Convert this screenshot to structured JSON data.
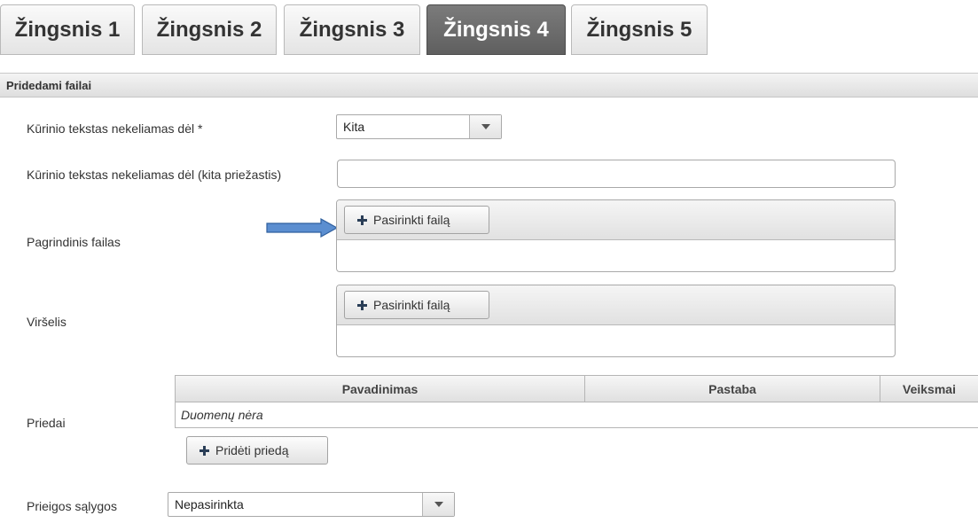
{
  "steps": [
    {
      "label": "Žingsnis 1",
      "active": false
    },
    {
      "label": "Žingsnis 2",
      "active": false
    },
    {
      "label": "Žingsnis 3",
      "active": false
    },
    {
      "label": "Žingsnis 4",
      "active": true
    },
    {
      "label": "Žingsnis 5",
      "active": false
    }
  ],
  "section": {
    "title": "Pridedami failai"
  },
  "form": {
    "reason": {
      "label": "Kūrinio tekstas nekeliamas dėl *",
      "value": "Kita"
    },
    "other_reason": {
      "label": "Kūrinio tekstas nekeliamas dėl (kita priežastis)",
      "value": ""
    },
    "main_file": {
      "label": "Pagrindinis failas",
      "button": "Pasirinkti failą"
    },
    "cover": {
      "label": "Viršelis",
      "button": "Pasirinkti failą"
    },
    "attachments": {
      "label": "Priedai",
      "columns": [
        "Pavadinimas",
        "Pastaba",
        "Veiksmai"
      ],
      "empty_text": "Duomenų nėra",
      "add_button": "Pridėti priedą"
    },
    "access": {
      "label": "Prieigos sąlygos",
      "value": "Nepasirinkta"
    }
  },
  "icons": {
    "plus": "plus-icon",
    "dropdown": "chevron-down-icon",
    "pointer": "arrow-right-icon"
  },
  "colors": {
    "active_tab": "#6b6b6b",
    "arrow_fill": "#5b8ed0",
    "arrow_stroke": "#2f5f9e"
  }
}
